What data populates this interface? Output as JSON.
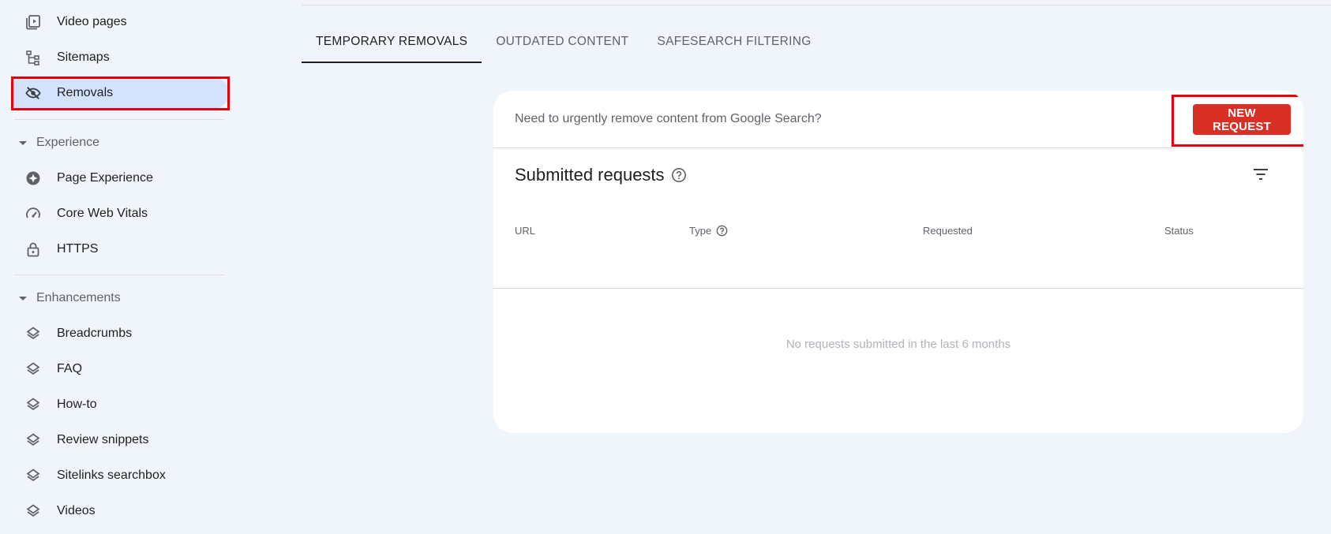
{
  "sidebar": {
    "items_top": [
      {
        "label": "Video pages",
        "icon": "video-pages-icon"
      },
      {
        "label": "Sitemaps",
        "icon": "sitemap-icon"
      },
      {
        "label": "Removals",
        "icon": "eye-off-icon"
      }
    ],
    "experience": {
      "header": "Experience",
      "items": [
        {
          "label": "Page Experience",
          "icon": "page-experience-icon"
        },
        {
          "label": "Core Web Vitals",
          "icon": "speedometer-icon"
        },
        {
          "label": "HTTPS",
          "icon": "lock-icon"
        }
      ]
    },
    "enhancements": {
      "header": "Enhancements",
      "items": [
        {
          "label": "Breadcrumbs",
          "icon": "layers-icon"
        },
        {
          "label": "FAQ",
          "icon": "layers-icon"
        },
        {
          "label": "How-to",
          "icon": "layers-icon"
        },
        {
          "label": "Review snippets",
          "icon": "layers-icon"
        },
        {
          "label": "Sitelinks searchbox",
          "icon": "layers-icon"
        },
        {
          "label": "Videos",
          "icon": "layers-icon"
        }
      ]
    }
  },
  "tabs": [
    {
      "label": "TEMPORARY REMOVALS",
      "active": true
    },
    {
      "label": "OUTDATED CONTENT",
      "active": false
    },
    {
      "label": "SAFESEARCH FILTERING",
      "active": false
    }
  ],
  "card": {
    "banner_text": "Need to urgently remove content from Google Search?",
    "new_request_label": "NEW REQUEST",
    "title": "Submitted requests",
    "columns": [
      "URL",
      "Type",
      "Requested",
      "Status"
    ],
    "empty_message": "No requests submitted in the last 6 months"
  },
  "colors": {
    "accent_red": "#d93025",
    "active_nav_bg": "#d3e3fd",
    "highlight_border": "#e8000b",
    "page_bg": "#f0f4fb"
  }
}
